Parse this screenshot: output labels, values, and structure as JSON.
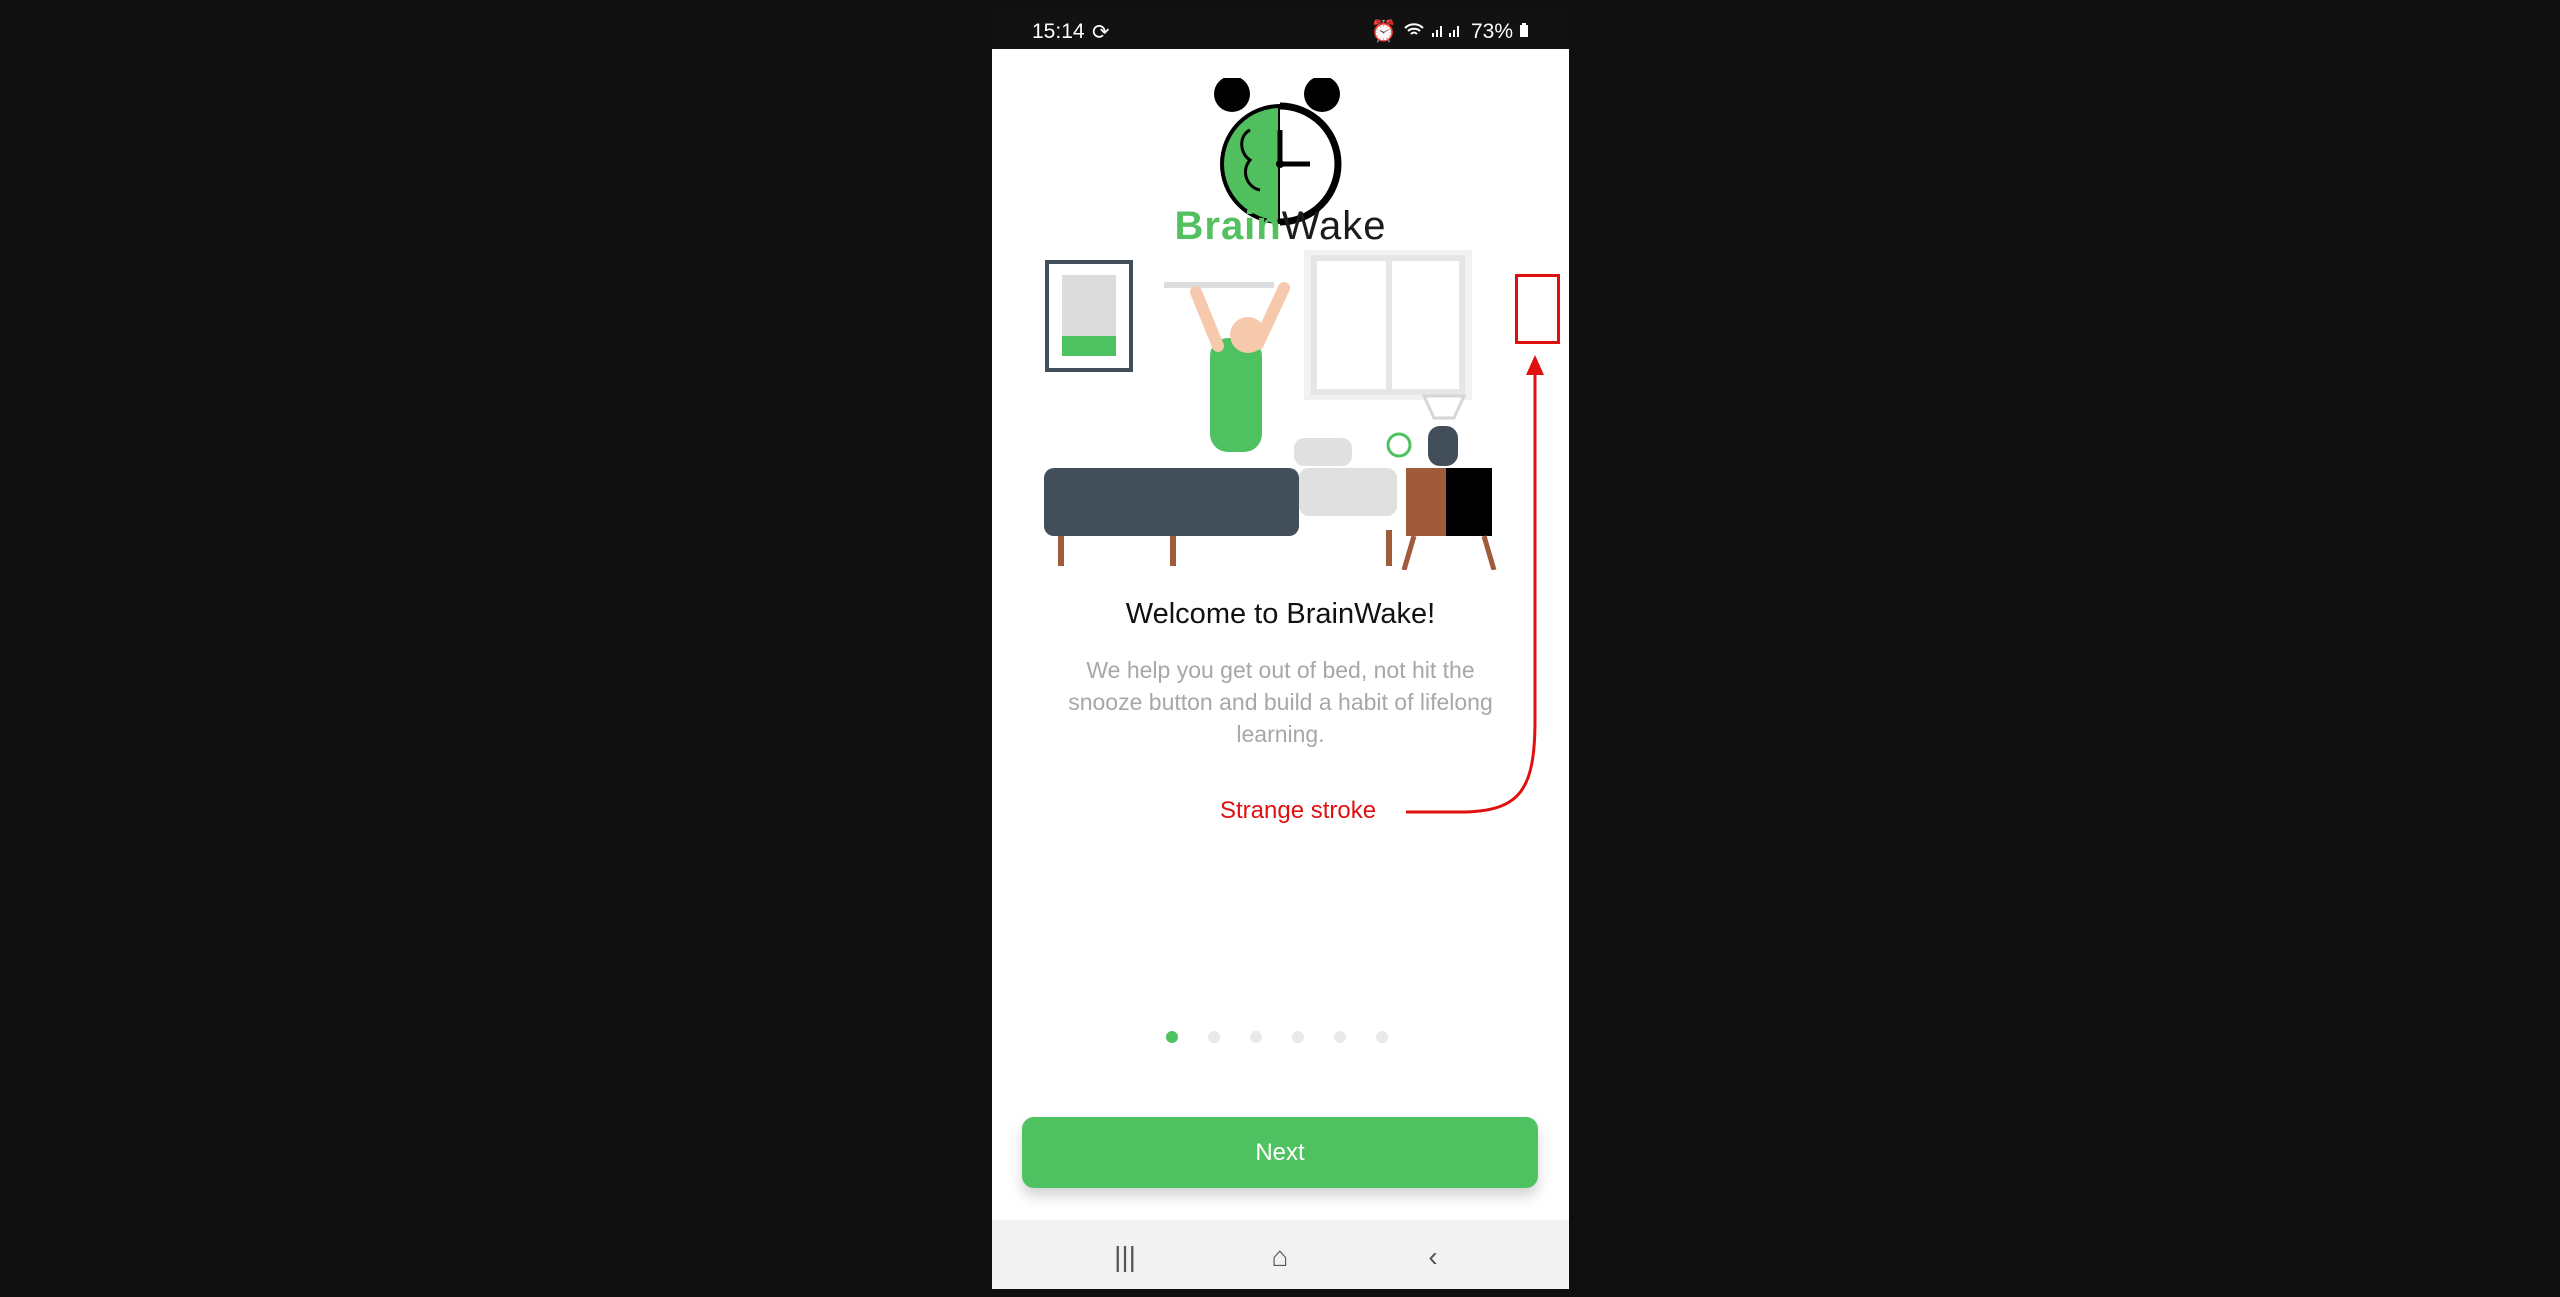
{
  "status_bar": {
    "time": "15:14",
    "battery": "73%"
  },
  "brand": {
    "part1": "Brain",
    "part2": "Wake"
  },
  "onboarding": {
    "title": "Welcome to BrainWake!",
    "subtitle": "We help you get out of bed, not hit the snooze button and build a habit of lifelong learning.",
    "pages": 6,
    "active_page": 1
  },
  "buttons": {
    "next": "Next"
  },
  "annotation": {
    "text": "Strange stroke",
    "color": "#e01010"
  },
  "colors": {
    "accent": "#4ec160",
    "text_dark": "#111111",
    "text_muted": "#a7a7a7"
  },
  "icons": [
    "sync-icon",
    "alarm-icon",
    "wifi-icon",
    "signal-icon",
    "battery-icon",
    "recents-icon",
    "home-icon",
    "back-icon"
  ]
}
